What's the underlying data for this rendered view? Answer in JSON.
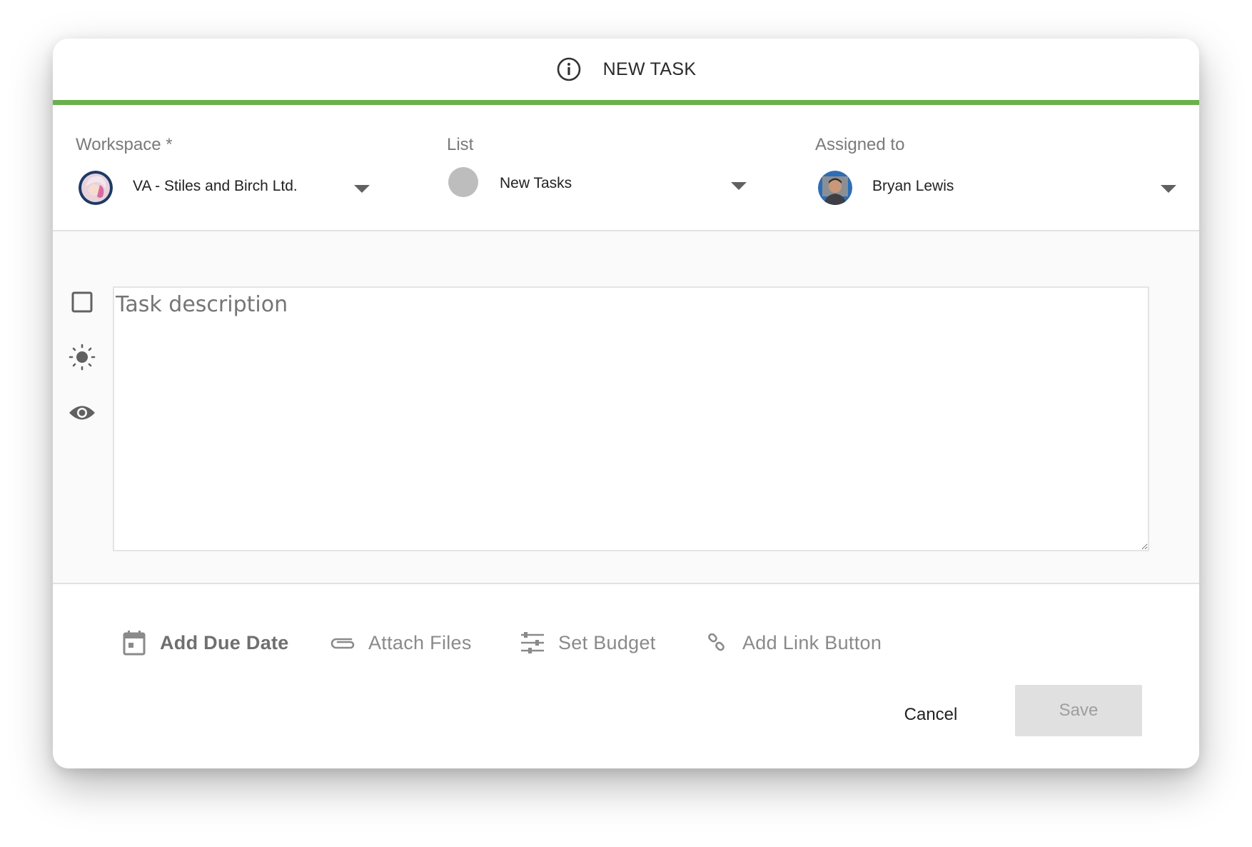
{
  "header": {
    "title": "NEW TASK",
    "accent_color": "#6ab04c"
  },
  "fields": {
    "workspace": {
      "label": "Workspace *",
      "value": "VA - Stiles and Birch Ltd."
    },
    "list": {
      "label": "List",
      "value": "New Tasks",
      "dot_color": "#bdbdbd"
    },
    "assigned": {
      "label": "Assigned to",
      "value": "Bryan Lewis"
    }
  },
  "description": {
    "placeholder": "Task description"
  },
  "side_icons": [
    "checkbox-icon",
    "sun-icon",
    "eye-icon"
  ],
  "actions": {
    "due_date": "Add Due Date",
    "attach": "Attach Files",
    "budget": "Set Budget",
    "link": "Add Link Button"
  },
  "buttons": {
    "cancel": "Cancel",
    "save": "Save"
  }
}
